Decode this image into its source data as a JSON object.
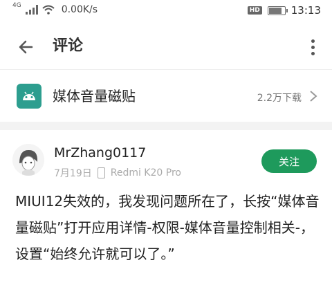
{
  "status_bar": {
    "network_tag": "4G",
    "speed": "0.00K/s",
    "hd_badge": "HD",
    "time": "13:13",
    "battery_level": 0.9
  },
  "app_bar": {
    "title": "评论",
    "back_icon": "back-arrow-icon",
    "more_icon": "more-vert-icon"
  },
  "app_info": {
    "name": "媒体音量磁贴",
    "downloads": "2.2万下载",
    "icon": "android-icon",
    "accent_color": "#2d9e8f"
  },
  "comment": {
    "username": "MrZhang0117",
    "date": "7月19日",
    "device": "Redmi K20 Pro",
    "follow_label": "关注",
    "follow_color": "#1e9a5c",
    "text": "MIUI12失效的，我发现问题所在了，长按“媒体音量磁贴”打开应用详情-权限-媒体音量控制相关-，设置“始终允许就可以了。”"
  }
}
